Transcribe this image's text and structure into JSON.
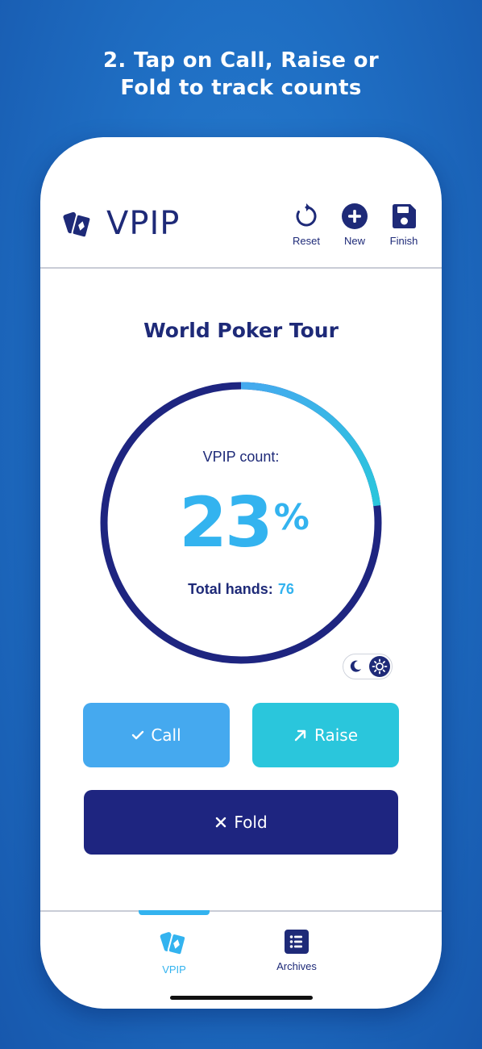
{
  "headline": {
    "line1": "2. Tap on Call, Raise or",
    "line2": "Fold to track counts"
  },
  "header": {
    "app_title": "VPIP",
    "actions": [
      {
        "label": "Reset",
        "icon": "reset-icon"
      },
      {
        "label": "New",
        "icon": "plus-circle-icon"
      },
      {
        "label": "Finish",
        "icon": "save-icon"
      }
    ]
  },
  "session": {
    "title": "World Poker Tour",
    "count_label": "VPIP count:",
    "percentage": "23",
    "percent_sign": "%",
    "progress": 0.23,
    "total_hands_label": "Total hands:",
    "total_hands_value": "76"
  },
  "actions": {
    "call": "Call",
    "raise": "Raise",
    "fold": "Fold"
  },
  "tabs": [
    {
      "label": "VPIP",
      "icon": "cards-icon",
      "active": true
    },
    {
      "label": "Archives",
      "icon": "list-icon",
      "active": false
    }
  ],
  "colors": {
    "navy": "#1e2a78",
    "accent_blue": "#33b3ef",
    "call": "#45a9ef",
    "raise": "#2ac6dc",
    "fold": "#1e2580",
    "background": "#1f6fc4"
  }
}
